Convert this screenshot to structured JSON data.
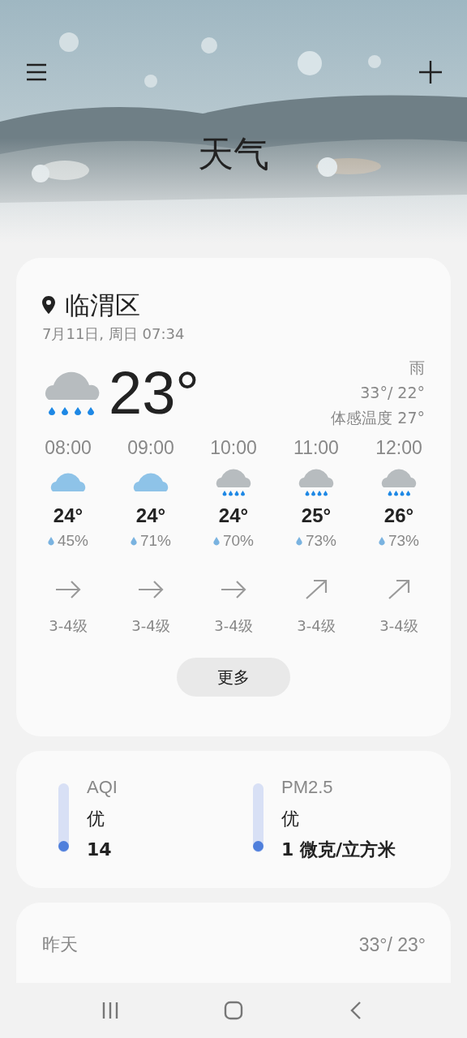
{
  "header": {
    "title": "天气"
  },
  "current": {
    "location": "临渭区",
    "datetime": "7月11日, 周日 07:34",
    "temperature": "23°",
    "kind": "rain",
    "condition": "雨",
    "high_low": "33°/ 22°",
    "feels_like": "体感温度 27°"
  },
  "hourly": [
    {
      "time": "08:00",
      "kind": "cloud",
      "temp": "24°",
      "humidity": "45%",
      "wind": {
        "kind": "east",
        "text": "3-4级"
      }
    },
    {
      "time": "09:00",
      "kind": "cloud",
      "temp": "24°",
      "humidity": "71%",
      "wind": {
        "kind": "east",
        "text": "3-4级"
      }
    },
    {
      "time": "10:00",
      "kind": "rain",
      "temp": "24°",
      "humidity": "70%",
      "wind": {
        "kind": "east",
        "text": "3-4级"
      }
    },
    {
      "time": "11:00",
      "kind": "rain",
      "temp": "25°",
      "humidity": "73%",
      "wind": {
        "kind": "northeast",
        "text": "3-4级"
      }
    },
    {
      "time": "12:00",
      "kind": "rain",
      "temp": "26°",
      "humidity": "73%",
      "wind": {
        "kind": "northeast",
        "text": "3-4级"
      }
    }
  ],
  "more_button": "更多",
  "air": [
    {
      "label": "AQI",
      "grade": "优",
      "value": "14",
      "level": 0.02
    },
    {
      "label": "PM2.5",
      "grade": "优",
      "value": "1 微克/立方米",
      "level": 0.02
    }
  ],
  "daily": [
    {
      "day": "昨天",
      "temps": "33°/ 23°"
    }
  ]
}
